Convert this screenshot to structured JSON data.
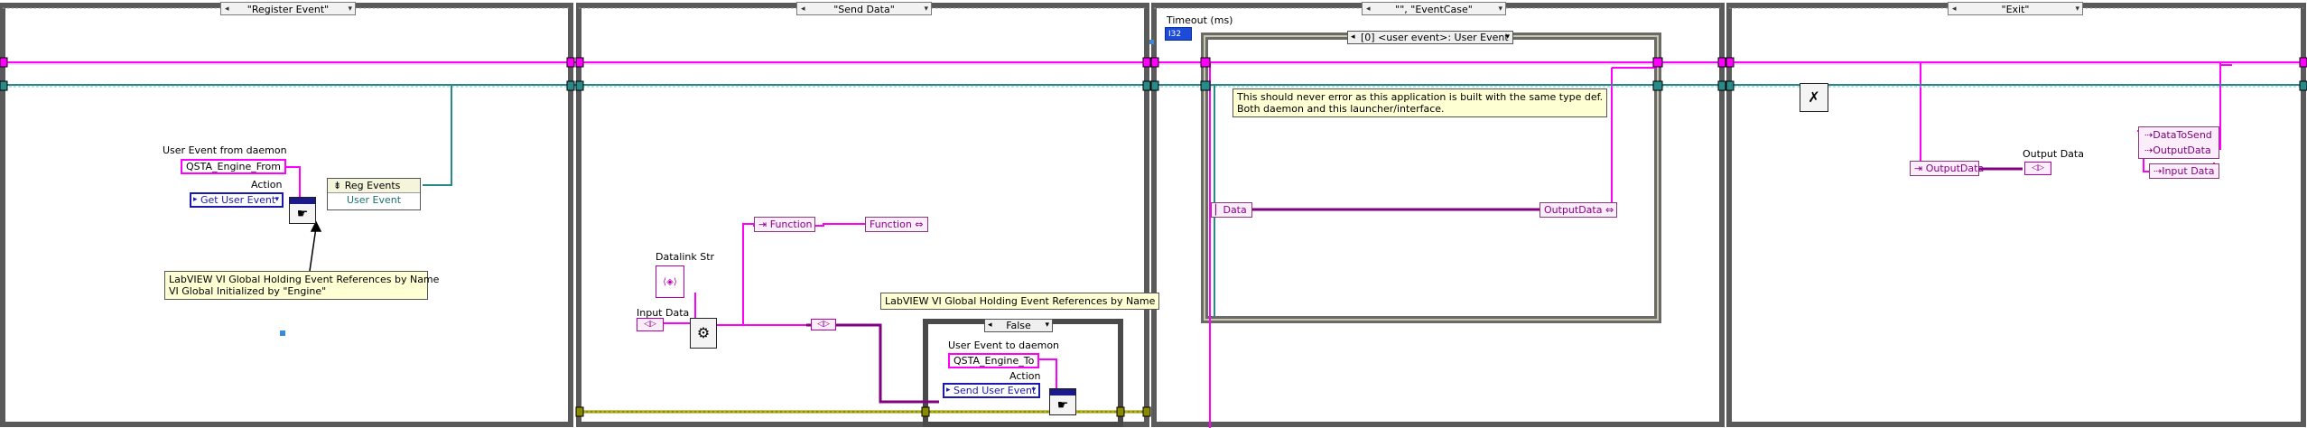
{
  "frames": [
    {
      "selector": "\"Register Event\""
    },
    {
      "selector": "\"Send Data\""
    },
    {
      "selector": "\"\", \"EventCase\""
    },
    {
      "selector": "\"Exit\""
    }
  ],
  "register_event": {
    "user_event_label": "User Event from daemon",
    "user_event_const": "QSTA_Engine_From",
    "action_label": "Action",
    "action_value": "Get User Event",
    "reg_events_label": "Reg Events",
    "user_event_term": "User Event",
    "global_note_line1": "LabVIEW VI Global Holding Event References by Name",
    "global_note_line2": "VI Global Initialized by \"Engine\""
  },
  "send_data": {
    "datalink_label": "Datalink Str",
    "input_data_label": "Input Data",
    "function_label_1": "Function",
    "function_label_2": "Function",
    "global_note": "LabVIEW VI Global Holding Event References by Name",
    "case_selector": "False",
    "user_event_label": "User Event to daemon",
    "user_event_const": "QSTA_Engine_To",
    "action_label": "Action",
    "action_value": "Send User Event"
  },
  "event_case": {
    "timeout_label": "Timeout (ms)",
    "event_selector_index": "[0]",
    "event_selector": "<user event>: User Event",
    "note_line1": "This should never error as this application is built with the same type def.",
    "note_line2": "Both daemon and this launcher/interface.",
    "data_node": "Data",
    "output_data_node": "OutputData"
  },
  "exit": {
    "output_data_node": "OutputData",
    "output_data_label": "Output Data",
    "bundle_row1": "DataToSend",
    "bundle_row2": "OutputData",
    "bundle_row3": "Input Data"
  }
}
